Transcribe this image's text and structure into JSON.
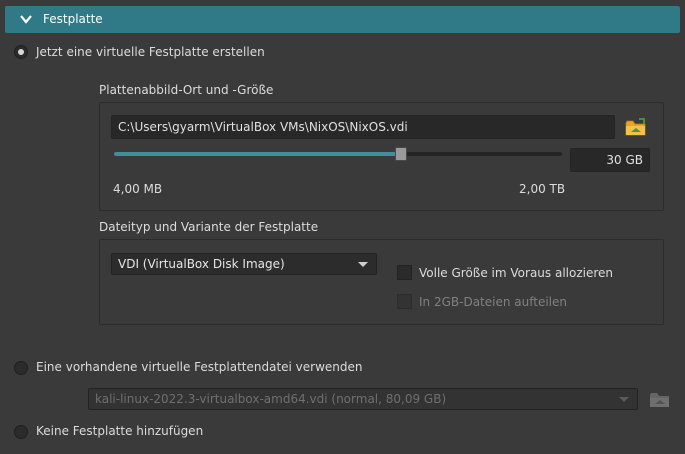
{
  "header": {
    "title": "Festplatte",
    "icon": "chevron-down-icon"
  },
  "options": {
    "create_new": {
      "label": "Jetzt eine virtuelle Festplatte erstellen",
      "checked": true
    },
    "use_existing": {
      "label": "Eine vorhandene virtuelle Festplattendatei verwenden",
      "checked": false
    },
    "no_disk": {
      "label": "Keine Festplatte hinzufügen",
      "checked": false
    }
  },
  "location_group": {
    "title": "Plattenabbild-Ort und -Größe",
    "path_value": "C:\\Users\\gyarm\\VirtualBox VMs\\NixOS\\NixOS.vdi",
    "folder_icon": "folder-icon",
    "size_value": "30 GB",
    "size_fraction": 0.64,
    "min_label": "4,00 MB",
    "max_label": "2,00 TB"
  },
  "type_group": {
    "title": "Dateityp und Variante der Festplatte",
    "file_type": "VDI (VirtualBox Disk Image)",
    "preallocate_label": "Volle Größe im Voraus allozieren",
    "preallocate_checked": false,
    "split_label": "In 2GB-Dateien aufteilen",
    "split_checked": false,
    "split_enabled": false
  },
  "existing": {
    "selected": "kali-linux-2022.3-virtualbox-amd64.vdi (normal, 80,09 GB)",
    "folder_icon": "folder-icon"
  },
  "colors": {
    "accent": "#2f7a86",
    "slider_fill": "#3d8f9e",
    "background": "#3a3a3a"
  }
}
